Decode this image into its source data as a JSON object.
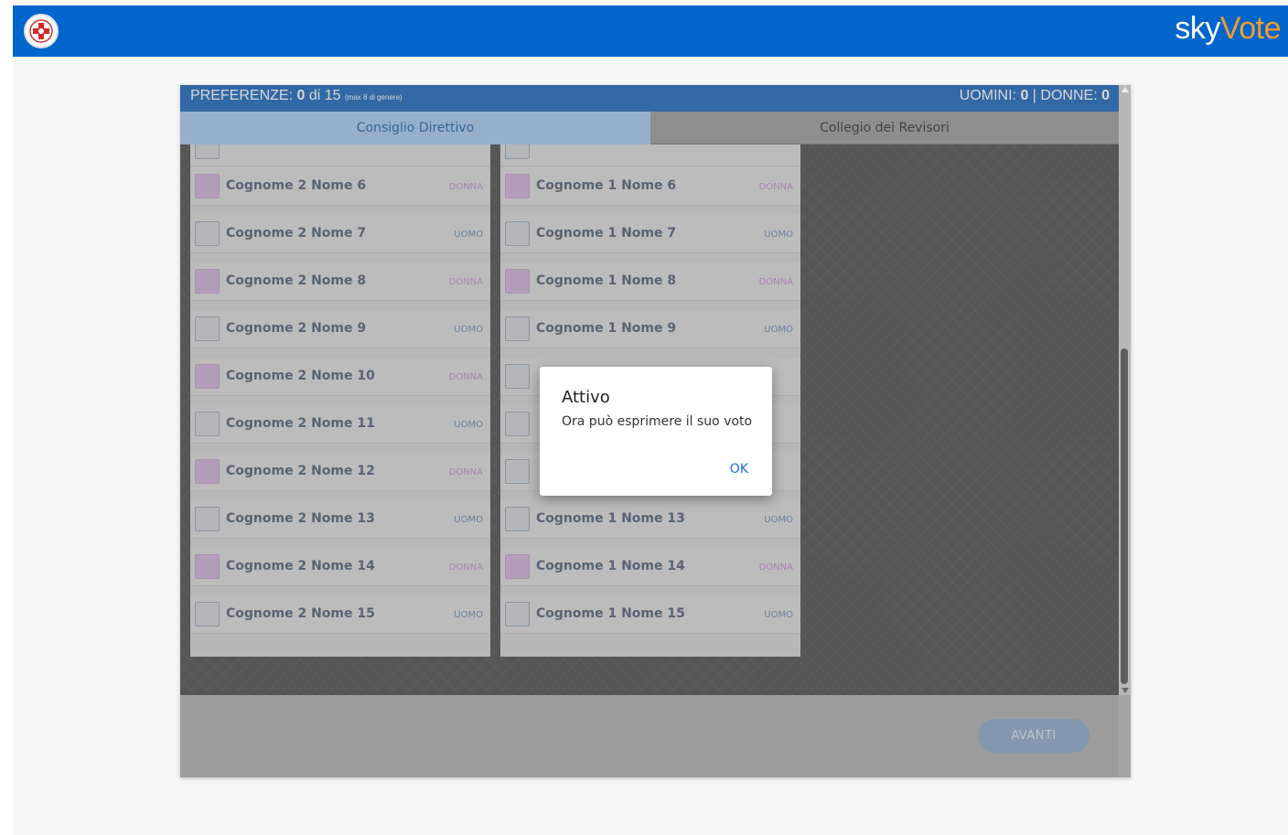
{
  "header": {
    "brand_sky": "sky",
    "brand_vote": "Vote",
    "brand_color": "#0066cc",
    "accent_color": "#f29a2e",
    "logo_icon": "red-cross-logo-icon"
  },
  "preferences": {
    "label": "PREFERENZE:",
    "count": "0",
    "of_total": "di 15",
    "max_note": "(max 8 di genere)",
    "men_label": "UOMINI:",
    "men_count": "0",
    "separator": "|",
    "women_label": "DONNE:",
    "women_count": "0"
  },
  "tabs": [
    {
      "label": "Consiglio Direttivo",
      "active": true
    },
    {
      "label": "Collegio dei Revisori",
      "active": false
    }
  ],
  "list_1": [
    {
      "name": "Cognome 2 Nome 6",
      "gender": "DONNA"
    },
    {
      "name": "Cognome 2 Nome 7",
      "gender": "UOMO"
    },
    {
      "name": "Cognome 2 Nome 8",
      "gender": "DONNA"
    },
    {
      "name": "Cognome 2 Nome 9",
      "gender": "UOMO"
    },
    {
      "name": "Cognome 2 Nome 10",
      "gender": "DONNA"
    },
    {
      "name": "Cognome 2 Nome 11",
      "gender": "UOMO"
    },
    {
      "name": "Cognome 2 Nome 12",
      "gender": "DONNA"
    },
    {
      "name": "Cognome 2 Nome 13",
      "gender": "UOMO"
    },
    {
      "name": "Cognome 2 Nome 14",
      "gender": "DONNA"
    },
    {
      "name": "Cognome 2 Nome 15",
      "gender": "UOMO"
    }
  ],
  "list_2": [
    {
      "name": "Cognome 1 Nome 6",
      "gender": "DONNA"
    },
    {
      "name": "Cognome 1 Nome 7",
      "gender": "UOMO"
    },
    {
      "name": "Cognome 1 Nome 8",
      "gender": "DONNA"
    },
    {
      "name": "Cognome 1 Nome 9",
      "gender": "UOMO"
    },
    {
      "name": "",
      "gender": ""
    },
    {
      "name": "",
      "gender": ""
    },
    {
      "name": "",
      "gender": ""
    },
    {
      "name": "Cognome 1 Nome 13",
      "gender": "UOMO"
    },
    {
      "name": "Cognome 1 Nome 14",
      "gender": "DONNA"
    },
    {
      "name": "Cognome 1 Nome 15",
      "gender": "UOMO"
    }
  ],
  "footer": {
    "next_label": "AVANTI"
  },
  "dialog": {
    "title": "Attivo",
    "message": "Ora può esprimere il suo voto",
    "ok_label": "OK"
  }
}
